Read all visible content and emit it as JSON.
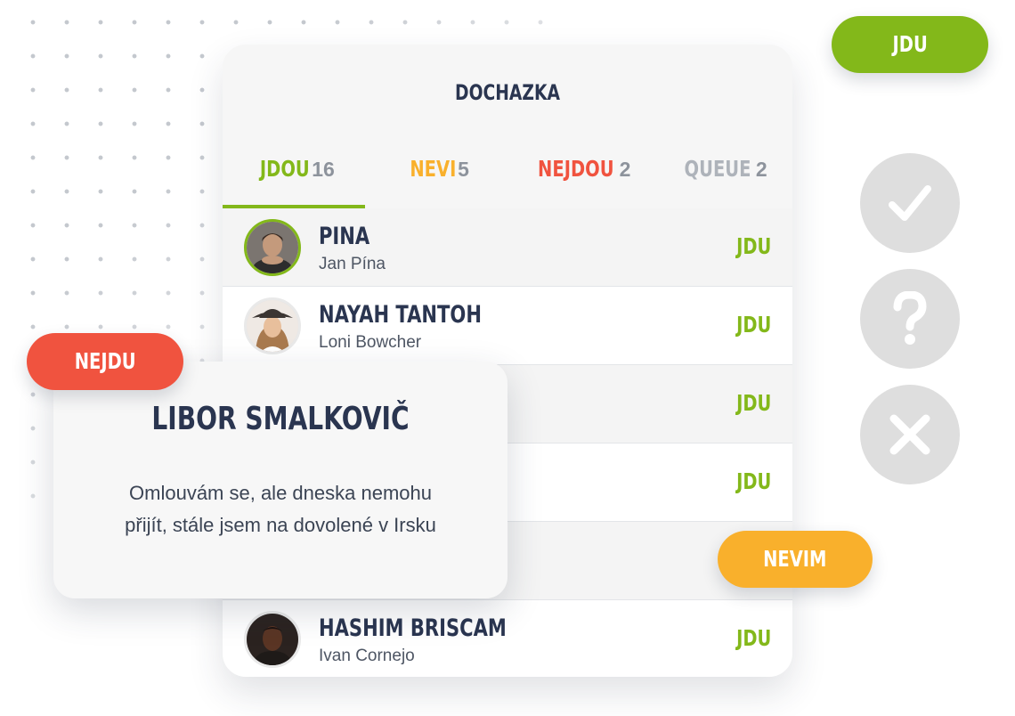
{
  "card": {
    "title": "DOCHAZKA",
    "tabs": [
      {
        "label": "JDOU",
        "count": "16",
        "color": "#83b81a"
      },
      {
        "label": "NEVI",
        "count": "5",
        "color": "#f9b02c"
      },
      {
        "label": "NEJDOU",
        "count": "2",
        "color": "#f0533f"
      },
      {
        "label": "QUEUE",
        "count": "2",
        "color": "#aeb3ba"
      }
    ],
    "rows": [
      {
        "name": "PINA",
        "subtitle": "Jan Pína",
        "status": "JDU"
      },
      {
        "name": "NAYAH TANTOH",
        "subtitle": "Loni Bowcher",
        "status": "JDU"
      },
      {
        "name": "",
        "subtitle": "",
        "status": "JDU"
      },
      {
        "name": "",
        "subtitle": "",
        "status": "JDU"
      },
      {
        "name": "",
        "subtitle": "",
        "status": ""
      },
      {
        "name": "HASHIM BRISCAM",
        "subtitle": "Ivan Cornejo",
        "status": "JDU"
      }
    ]
  },
  "buttons": {
    "jdu": "JDU",
    "nejdu": "NEJDU",
    "nevim": "NEVIM"
  },
  "popup": {
    "name": "LIBOR SMALKOVIČ",
    "message_line1": "Omlouvám se, ale dneska nemohu",
    "message_line2": "přijít, stále jsem na dovolené v Irsku"
  },
  "icons": {
    "yes": "check-icon",
    "maybe": "question-icon",
    "no": "close-icon"
  },
  "colors": {
    "green": "#83b81a",
    "orange": "#f9b02c",
    "red": "#f0533f",
    "navy": "#2a3550",
    "grey": "#dedede"
  }
}
